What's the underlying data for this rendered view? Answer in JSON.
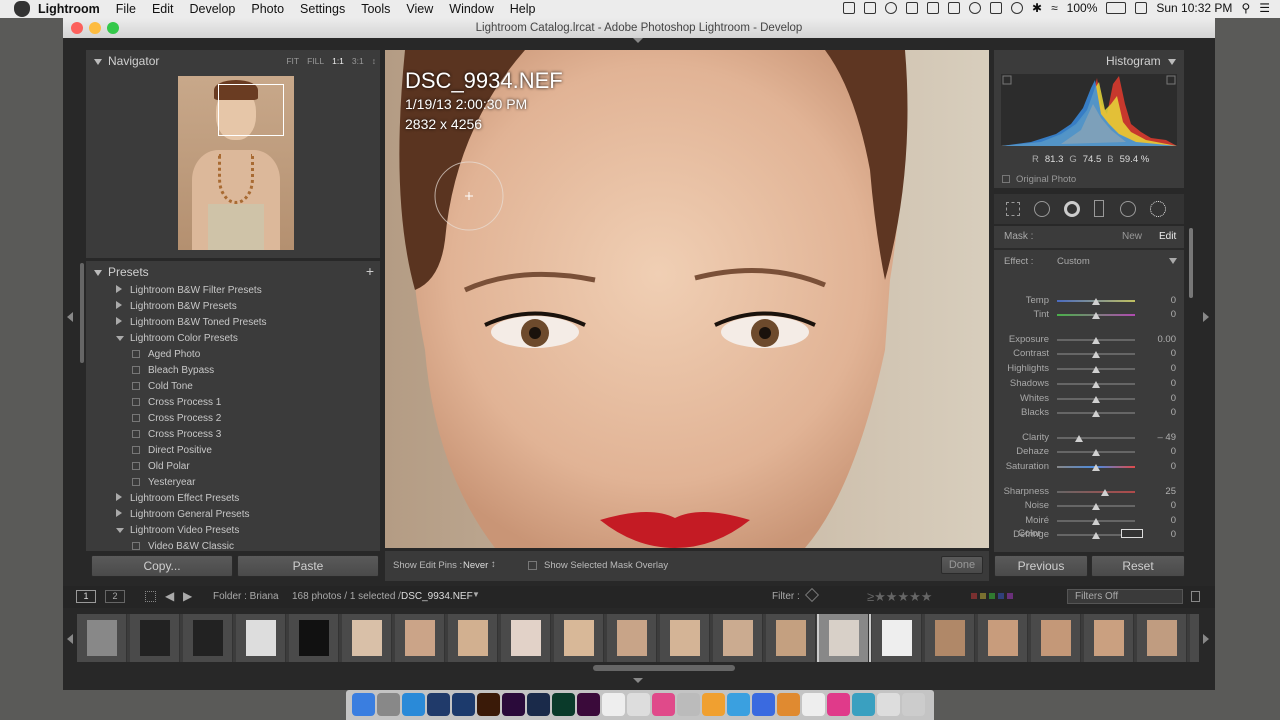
{
  "menubar": {
    "app": "Lightroom",
    "items": [
      "File",
      "Edit",
      "Develop",
      "Photo",
      "Settings",
      "Tools",
      "View",
      "Window",
      "Help"
    ],
    "battery": "100%",
    "clock": "Sun 10:32 PM"
  },
  "window": {
    "title": "Lightroom Catalog.lrcat - Adobe Photoshop Lightroom - Develop"
  },
  "navigator": {
    "title": "Navigator",
    "zoom_options": [
      "FIT",
      "FILL",
      "1:1",
      "3:1"
    ]
  },
  "presets": {
    "title": "Presets",
    "add": "+",
    "rows": [
      {
        "label": "Lightroom B&W Filter Presets",
        "type": "folder",
        "open": false
      },
      {
        "label": "Lightroom B&W Presets",
        "type": "folder",
        "open": false
      },
      {
        "label": "Lightroom B&W Toned Presets",
        "type": "folder",
        "open": false
      },
      {
        "label": "Lightroom Color Presets",
        "type": "folder",
        "open": true
      },
      {
        "label": "Aged Photo",
        "type": "item"
      },
      {
        "label": "Bleach Bypass",
        "type": "item"
      },
      {
        "label": "Cold Tone",
        "type": "item"
      },
      {
        "label": "Cross Process 1",
        "type": "item"
      },
      {
        "label": "Cross Process 2",
        "type": "item"
      },
      {
        "label": "Cross Process 3",
        "type": "item"
      },
      {
        "label": "Direct Positive",
        "type": "item"
      },
      {
        "label": "Old Polar",
        "type": "item"
      },
      {
        "label": "Yesteryear",
        "type": "item"
      },
      {
        "label": "Lightroom Effect Presets",
        "type": "folder",
        "open": false
      },
      {
        "label": "Lightroom General Presets",
        "type": "folder",
        "open": false
      },
      {
        "label": "Lightroom Video Presets",
        "type": "folder",
        "open": true
      },
      {
        "label": "Video B&W Classic",
        "type": "item"
      }
    ],
    "copy_label": "Copy...",
    "paste_label": "Paste"
  },
  "photo": {
    "filename": "DSC_9934.NEF",
    "datetime": "1/19/13 2:00:30 PM",
    "dimensions": "2832 x 4256"
  },
  "toolbar": {
    "edit_pins_label": "Show Edit Pins :",
    "edit_pins_value": "Never",
    "mask_overlay_label": "Show Selected Mask Overlay",
    "done_label": "Done"
  },
  "histogram": {
    "title": "Histogram",
    "r_label": "R",
    "r_value": "81.3",
    "g_label": "G",
    "g_value": "74.5",
    "b_label": "B",
    "b_value": "59.4 %",
    "original_photo": "Original Photo"
  },
  "mask": {
    "label": "Mask :",
    "new_label": "New",
    "edit_label": "Edit",
    "effect_label": "Effect :",
    "effect_value": "Custom",
    "color_label": "Color"
  },
  "sliders": [
    {
      "label": "Temp",
      "value": "0",
      "pos": 0.5,
      "track": "temp"
    },
    {
      "label": "Tint",
      "value": "0",
      "pos": 0.5,
      "track": "tint"
    },
    {
      "label": "Exposure",
      "value": "0.00",
      "pos": 0.5,
      "track": "grey"
    },
    {
      "label": "Contrast",
      "value": "0",
      "pos": 0.5,
      "track": "grey"
    },
    {
      "label": "Highlights",
      "value": "0",
      "pos": 0.5,
      "track": "grey"
    },
    {
      "label": "Shadows",
      "value": "0",
      "pos": 0.5,
      "track": "grey"
    },
    {
      "label": "Whites",
      "value": "0",
      "pos": 0.5,
      "track": "grey"
    },
    {
      "label": "Blacks",
      "value": "0",
      "pos": 0.5,
      "track": "grey"
    },
    {
      "label": "Clarity",
      "value": "– 49",
      "pos": 0.28,
      "track": "grey"
    },
    {
      "label": "Dehaze",
      "value": "0",
      "pos": 0.5,
      "track": "grey"
    },
    {
      "label": "Saturation",
      "value": "0",
      "pos": 0.5,
      "track": "sat"
    },
    {
      "label": "Sharpness",
      "value": "25",
      "pos": 0.62,
      "track": "sharp"
    },
    {
      "label": "Noise",
      "value": "0",
      "pos": 0.5,
      "track": "grey"
    },
    {
      "label": "Moiré",
      "value": "0",
      "pos": 0.5,
      "track": "grey"
    },
    {
      "label": "Defringe",
      "value": "0",
      "pos": 0.5,
      "track": "grey"
    }
  ],
  "right_buttons": {
    "previous": "Previous",
    "reset": "Reset"
  },
  "filmstrip_bar": {
    "view1": "1",
    "view2": "2",
    "folder": "Folder : Briana",
    "count": "168 photos / 1 selected /",
    "current": "DSC_9934.NEF",
    "filter_label": "Filter :",
    "filter_value": "Filters Off"
  },
  "colors": {
    "accent_red": "#d93a2f",
    "panel_bg": "#3b3b3b",
    "window_bg": "#282828"
  }
}
